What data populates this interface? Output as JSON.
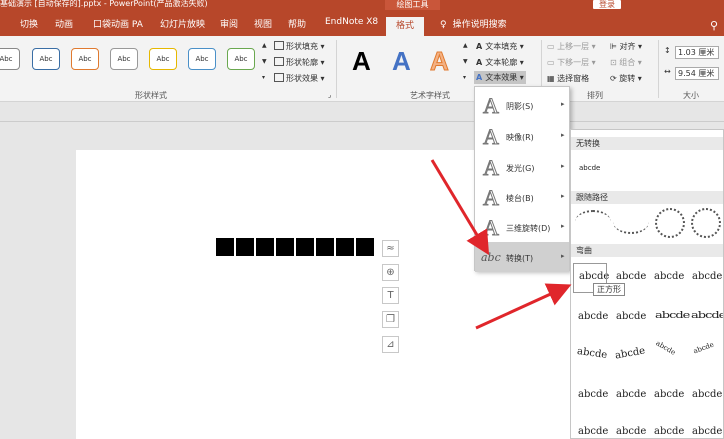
{
  "titlebar": {
    "document": "基础演示 [自动保存的].pptx - PowerPoint(产品激活失败)",
    "context_tool": "绘图工具",
    "login": "登录"
  },
  "tabs": {
    "items": [
      "切换",
      "动画",
      "口袋动画 PA",
      "幻灯片放映",
      "审阅",
      "视图",
      "帮助",
      "EndNote X8"
    ],
    "active": "格式",
    "tell_me": "操作说明搜索"
  },
  "ribbon": {
    "shape_styles": {
      "sample": "Abc",
      "fill": "形状填充",
      "outline": "形状轮廓",
      "effects": "形状效果",
      "label": "形状样式"
    },
    "wordart": {
      "sample": "A",
      "text_fill": "文本填充",
      "text_outline": "文本轮廓",
      "text_effects": "文本效果",
      "label": "艺术字样式"
    },
    "arrange": {
      "bring_forward": "上移一层",
      "send_backward": "下移一层",
      "selection_pane": "选择窗格",
      "align": "对齐",
      "group": "组合",
      "rotate": "旋转",
      "label": "排列"
    },
    "size": {
      "height": "1.03 厘米",
      "width": "9.54 厘米",
      "label": "大小"
    }
  },
  "effects_menu": {
    "items": [
      {
        "label": "阴影(S)"
      },
      {
        "label": "映像(R)"
      },
      {
        "label": "发光(G)"
      },
      {
        "label": "棱台(B)"
      },
      {
        "label": "三维旋转(D)"
      },
      {
        "label": "转换(T)",
        "icon_text": "abc"
      }
    ]
  },
  "transform_gallery": {
    "no_transform": "无转换",
    "none_sample": "abcde",
    "follow_path": "跟随路径",
    "warp": "弯曲",
    "warp_sample": "abcde",
    "tooltip": "正方形"
  },
  "colors": {
    "accent": "#b7472a",
    "arrow": "#e0262b"
  }
}
